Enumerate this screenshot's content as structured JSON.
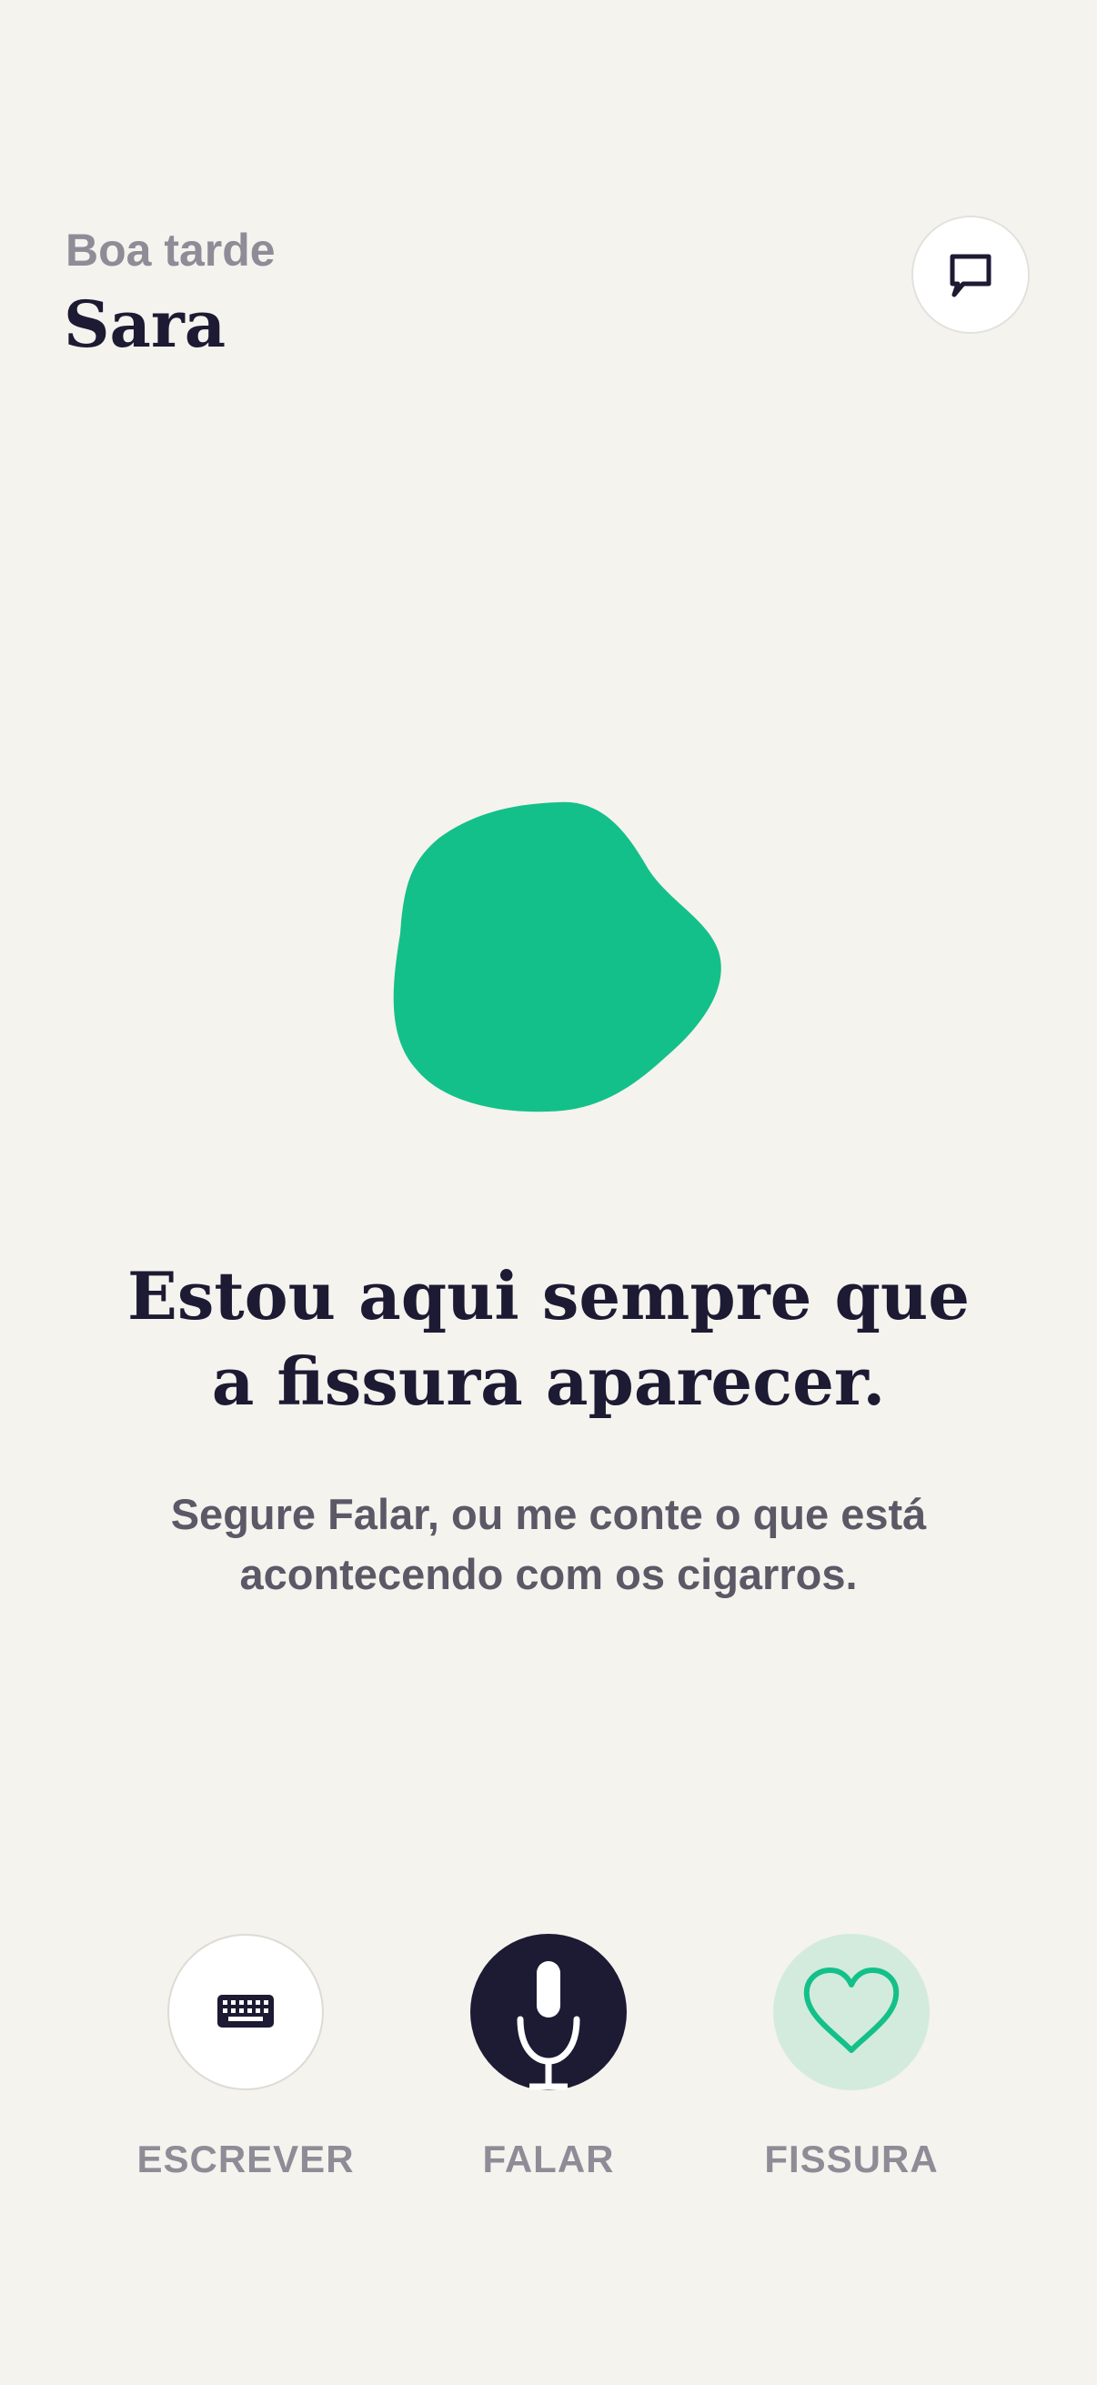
{
  "header": {
    "greeting": "Boa tarde",
    "user_name": "Sara",
    "chat_icon": "chat-bubble-icon"
  },
  "main": {
    "headline_lines": [
      "Estou aqui sempre que",
      "a fissura aparecer."
    ],
    "subtext_lines": [
      "Segure Falar, ou me conte o que está",
      "acontecendo com os cigarros."
    ]
  },
  "actions": [
    {
      "label": "ESCREVER",
      "icon": "keyboard-icon"
    },
    {
      "label": "FALAR",
      "icon": "microphone-icon"
    },
    {
      "label": "FISSURA",
      "icon": "heart-icon"
    }
  ],
  "colors": {
    "background": "#F5F3EE",
    "primary_dark": "#1D1A33",
    "accent_green": "#14C08A",
    "accent_green_light": "#D3EBDC",
    "muted_text": "#8E8C96"
  }
}
